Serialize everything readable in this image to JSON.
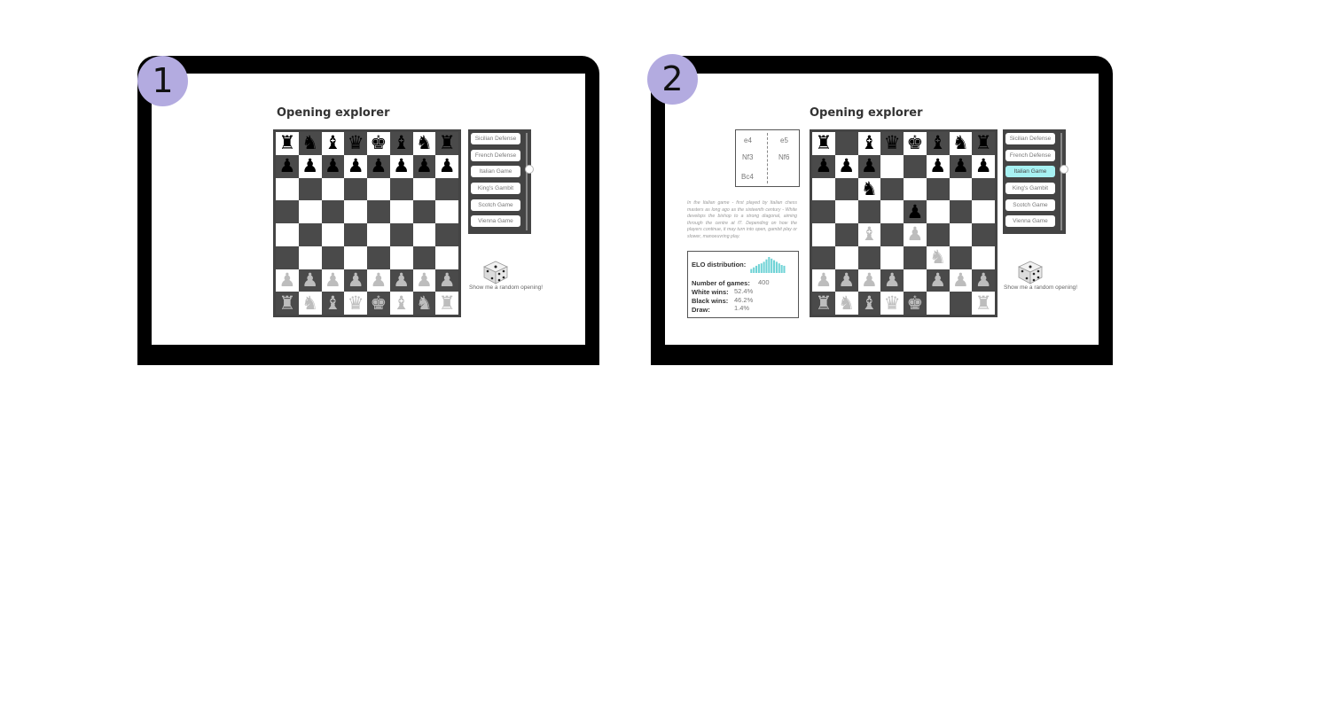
{
  "panels": [
    {
      "badge": "1",
      "title": "Opening explorer",
      "board": [
        "rnbqkbnr",
        "pppppppp",
        "........",
        "........",
        "........",
        "........",
        "PPPPPPPP",
        "RNBQKBNR"
      ],
      "openings": [
        {
          "label": "Sicilian Defense",
          "active": false
        },
        {
          "label": "French Defense",
          "active": false
        },
        {
          "label": "Italian Game",
          "active": false
        },
        {
          "label": "King's Gambit",
          "active": false
        },
        {
          "label": "Scotch Game",
          "active": false
        },
        {
          "label": "Vienna Game",
          "active": false
        }
      ],
      "random_label": "Show me a random opening!"
    },
    {
      "badge": "2",
      "title": "Opening explorer",
      "board": [
        "r.bqkbnr",
        "ppp..ppp",
        "..n.....",
        "....p...",
        "..B.P...",
        ".....N..",
        "PPPP.PPP",
        "RNBQK..R"
      ],
      "openings": [
        {
          "label": "Sicilian Defense",
          "active": false
        },
        {
          "label": "French Defense",
          "active": false
        },
        {
          "label": "Italian Game",
          "active": true
        },
        {
          "label": "King's Gambit",
          "active": false
        },
        {
          "label": "Scotch Game",
          "active": false
        },
        {
          "label": "Vienna Game",
          "active": false
        }
      ],
      "random_label": "Show me a random opening!",
      "moves": {
        "white": [
          "e4",
          "Nf3",
          "Bc4"
        ],
        "black": [
          "e5",
          "Nf6"
        ]
      },
      "description": "In the Italian game - first played by Italian chess masters as long ago as the sixteenth century - White develops the bishop to a strong diagonal, aiming through the centre at f7. Depending on how the players continue, it may turn into open, gambit play or slower, manoeuvring play.",
      "stats": {
        "elo_label": "ELO distribution:",
        "elo_histogram": [
          0.25,
          0.35,
          0.45,
          0.55,
          0.6,
          0.7,
          0.85,
          1.0,
          0.9,
          0.8,
          0.7,
          0.6,
          0.5,
          0.45
        ],
        "rows": [
          {
            "label": "Number of games:",
            "value": "400"
          },
          {
            "label": "White wins:",
            "value": "52.4%"
          },
          {
            "label": "Black wins:",
            "value": "46.2%"
          },
          {
            "label": "Draw:",
            "value": "1.4%"
          }
        ]
      }
    }
  ],
  "colors": {
    "badge": "#b3abe0",
    "active_item": "#a7f1f2",
    "histogram": "#6fd3d6",
    "dark_square": "#4a4a4a"
  }
}
